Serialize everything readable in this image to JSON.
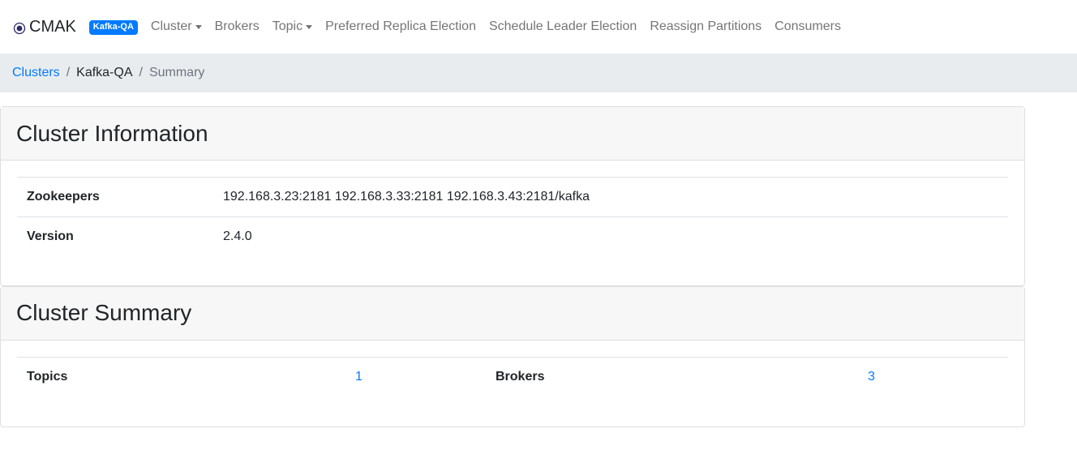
{
  "navbar": {
    "brand": "CMAK",
    "cluster_badge": "Kafka-QA",
    "items": [
      {
        "label": "Cluster",
        "dropdown": true
      },
      {
        "label": "Brokers",
        "dropdown": false
      },
      {
        "label": "Topic",
        "dropdown": true
      },
      {
        "label": "Preferred Replica Election",
        "dropdown": false
      },
      {
        "label": "Schedule Leader Election",
        "dropdown": false
      },
      {
        "label": "Reassign Partitions",
        "dropdown": false
      },
      {
        "label": "Consumers",
        "dropdown": false
      }
    ]
  },
  "breadcrumb": {
    "clusters": "Clusters",
    "sep1": "/",
    "cluster": "Kafka-QA",
    "sep2": "/",
    "current": "Summary"
  },
  "cluster_info": {
    "title": "Cluster Information",
    "zookeepers_label": "Zookeepers",
    "zookeepers_value": "192.168.3.23:2181 192.168.3.33:2181 192.168.3.43:2181/kafka",
    "version_label": "Version",
    "version_value": "2.4.0"
  },
  "cluster_summary": {
    "title": "Cluster Summary",
    "topics_label": "Topics",
    "topics_value": "1",
    "brokers_label": "Brokers",
    "brokers_value": "3"
  },
  "colors": {
    "accent": "#007bff",
    "breadcrumb_bg": "#e9ecef",
    "card_header_bg": "#f7f7f7"
  },
  "icons": {
    "brand": "radio-circle-icon"
  }
}
